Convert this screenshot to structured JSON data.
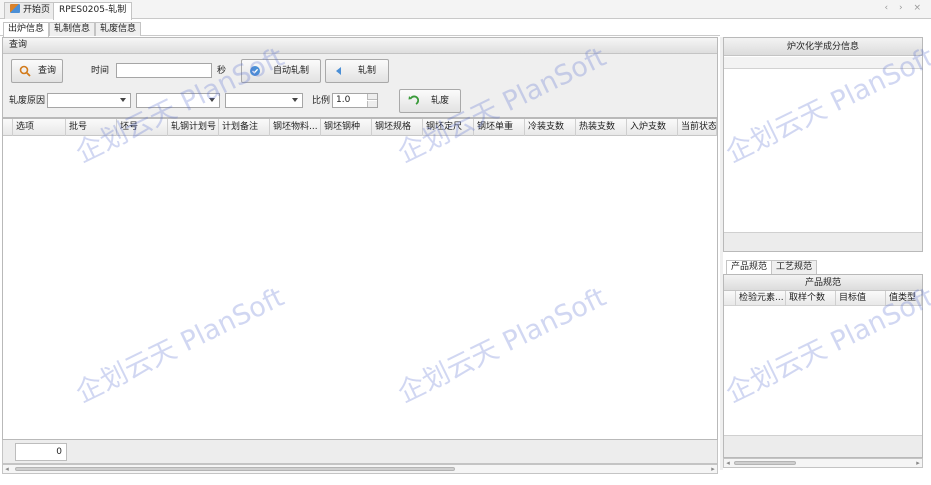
{
  "doc_tabs": [
    {
      "label": "开始页",
      "active": false
    },
    {
      "label": "RPES0205-轧制",
      "active": true
    }
  ],
  "nav_arrows": "‹ › ×",
  "sub_tabs": [
    "出炉信息",
    "轧制信息",
    "轧废信息"
  ],
  "query": {
    "header": "查询",
    "query_button": "查询",
    "time_label": "时间",
    "time_value": "",
    "seconds_label": "秒",
    "auto_roll_button": "自动轧制",
    "roll_button": "轧制",
    "scrap_reason_label": "轧废原因",
    "ratio_label": "比例",
    "ratio_value": "1.0",
    "scrap_button": "轧废"
  },
  "grid": {
    "columns": [
      "选项",
      "批号",
      "坯号",
      "轧钢计划号",
      "计划备注",
      "钢坯物料...",
      "钢坯钢种",
      "钢坯规格",
      "钢坯定尺",
      "钢坯单重",
      "冷装支数",
      "热装支数",
      "入炉支数",
      "当前状态"
    ],
    "row_count": "0"
  },
  "chem_panel": {
    "title": "炉次化学成分信息"
  },
  "spec_tabs": [
    "产品规范",
    "工艺规范"
  ],
  "spec_panel": {
    "title": "产品规范",
    "columns": [
      "检验元素...",
      "取样个数",
      "目标值",
      "值类型"
    ]
  },
  "watermark_text": "企划云天 PlanSoft",
  "colors": {
    "accent": "#4b8fd6",
    "watermark": "#5a6ed2"
  }
}
